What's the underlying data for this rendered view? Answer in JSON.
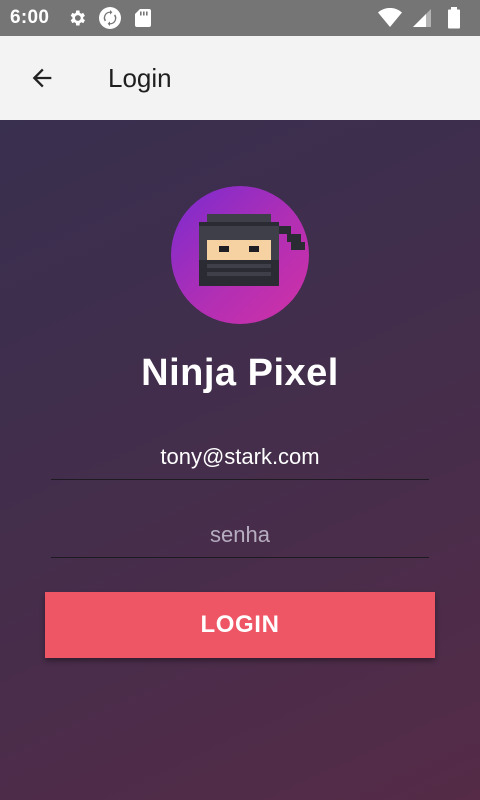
{
  "status_bar": {
    "time": "6:00",
    "left_icons": [
      "gear-icon",
      "sync-icon",
      "sd-card-icon"
    ],
    "right_icons": [
      "wifi-icon",
      "cell-signal-icon",
      "battery-icon"
    ]
  },
  "app_bar": {
    "title": "Login",
    "back_icon": "arrow-back-icon"
  },
  "login": {
    "avatar": "ninja-pixel-avatar",
    "brand_title": "Ninja Pixel",
    "email_value": "tony@stark.com",
    "password_placeholder": "senha",
    "button_label": "LOGIN"
  },
  "colors": {
    "status_bar": "#757575",
    "app_bar": "#f3f3f3",
    "background_start": "#392f4f",
    "background_end": "#552b47",
    "button": "#ee5565",
    "avatar_start": "#7a2bd0",
    "avatar_end": "#d230a6"
  }
}
